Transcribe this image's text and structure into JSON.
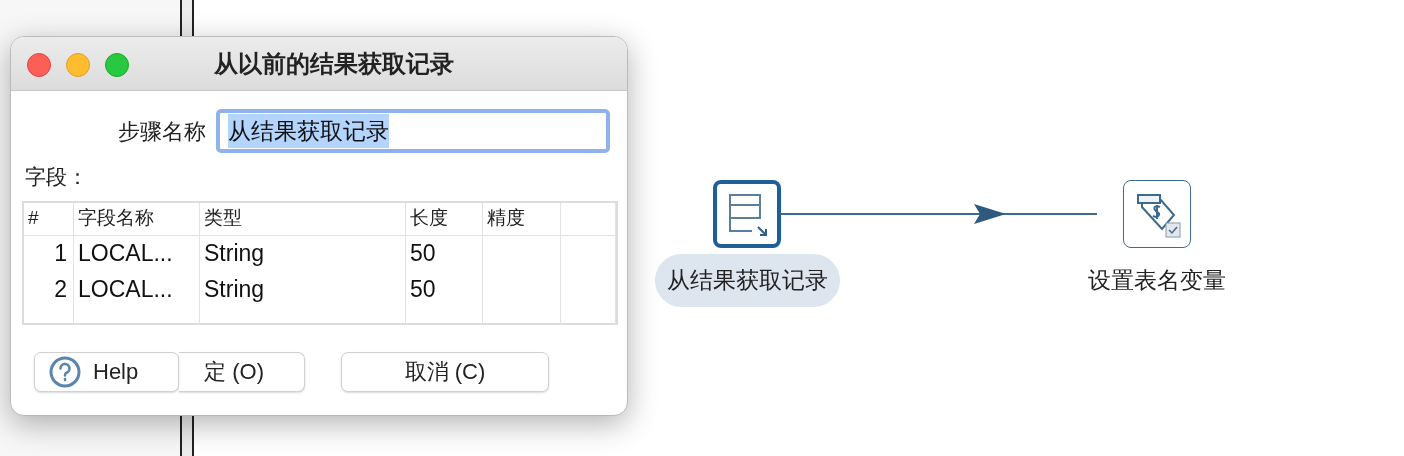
{
  "dialog": {
    "title": "从以前的结果获取记录",
    "step_name": {
      "label": "步骤名称",
      "value": "从结果获取记录",
      "focused": true
    },
    "fields_label": "字段：",
    "table": {
      "columns": [
        "#",
        "字段名称",
        "类型",
        "长度",
        "精度"
      ],
      "rows": [
        [
          "1",
          "LOCAL...",
          "String",
          "50",
          ""
        ],
        [
          "2",
          "LOCAL...",
          "String",
          "50",
          ""
        ]
      ]
    },
    "buttons": [
      {
        "kind": "help",
        "label": "Help"
      },
      {
        "kind": "ok",
        "label": "定 (O)"
      },
      {
        "kind": "cancel",
        "label": "取消 (C)"
      }
    ]
  },
  "canvas": {
    "nodes": [
      {
        "kind": "records",
        "label": "从结果获取记录",
        "selected": true
      },
      {
        "kind": "variable",
        "label": "设置表名变量",
        "selected": false
      }
    ]
  }
}
